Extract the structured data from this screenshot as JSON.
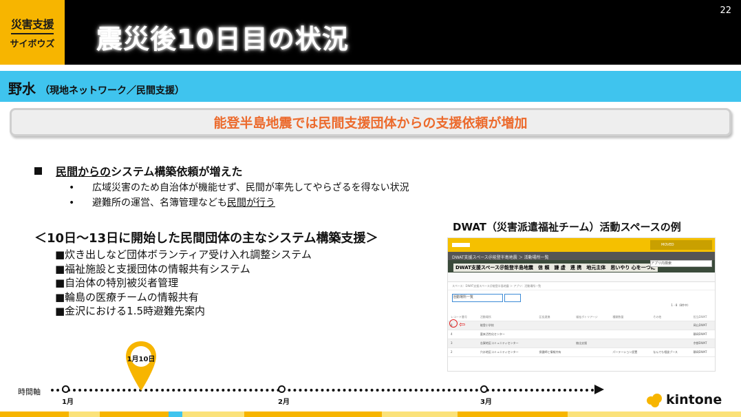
{
  "header": {
    "logo_line1": "災害支援",
    "logo_line2": "サイボウズ",
    "title": "震災後10日目の状況",
    "page_number": "22"
  },
  "section": {
    "title": "野水",
    "subtitle": "（現地ネットワーク／民間支援）"
  },
  "highlight": "能登半島地震では民間支援団体からの支援依頼が増加",
  "main_point": {
    "prefix": "民間からの",
    "rest": "システム構築依頼が増えた"
  },
  "sub_points": [
    {
      "bullet": "•",
      "text": "広域災害のため自治体が機能せず、民間が率先してやらざるを得ない状況"
    },
    {
      "bullet": "•",
      "text_before": "避難所の運営、名簿管理なども",
      "text_underlined": "民間が行う"
    }
  ],
  "systems": {
    "heading": "＜10日～13日に開始した民間団体の主なシステム構築支援＞",
    "items": [
      "■炊き出しなど団体ボランティア受け入れ調整システム",
      "■福祉施設と支援団体の情報共有システム",
      "■自治体の特別被災者管理",
      "■輪島の医療チームの情報共有",
      "■金沢における1.5時避難先案内"
    ]
  },
  "dwat": {
    "caption": "DWAT（災害派遣福祉チーム）活動スペースの例",
    "screenshot": {
      "dropdown": "MOVED",
      "nav": "DWAT支援スペース＠能登半島地震 ＞ 活動場所一覧",
      "banner": "DWAT支援スペース＠能登半島地震　信 頼　謙 虚　連 携　地元主体　思いやり 心を一つに",
      "search_placeholder": "アプリ内検索",
      "breadcrumb": "スペース：DWAT支援スペース＠能登半島地震 ＞ アプリ：活動場所一覧",
      "view_select": "活動場所一覧",
      "count": "1 - 8（8件中）",
      "columns": [
        "レコード番号",
        "活動場所",
        "区長連携",
        "福祉ボトリアージ",
        "種類数量",
        "その他",
        "担当DWAT"
      ],
      "rows": [
        [
          "8",
          "能登小学校",
          "",
          "",
          "",
          "",
          "岡山DWAT"
        ],
        [
          "4",
          "富来活性化センター",
          "",
          "",
          "",
          "",
          "静岡DWAT"
        ],
        [
          "3",
          "志賀地区コミュニティセンター",
          "",
          "抽出支援",
          "",
          "",
          "京都DWAT"
        ],
        [
          "2",
          "穴水地区コミュニティセンター",
          "保健師と情報共有",
          "",
          "パーテーション設置",
          "なんでも相談ブース",
          "静岡DWAT"
        ]
      ]
    }
  },
  "timeline": {
    "axis_label": "時間軸",
    "marker": "1月10日",
    "ticks": [
      "1月",
      "2月",
      "3月"
    ]
  },
  "brand": "kintone"
}
